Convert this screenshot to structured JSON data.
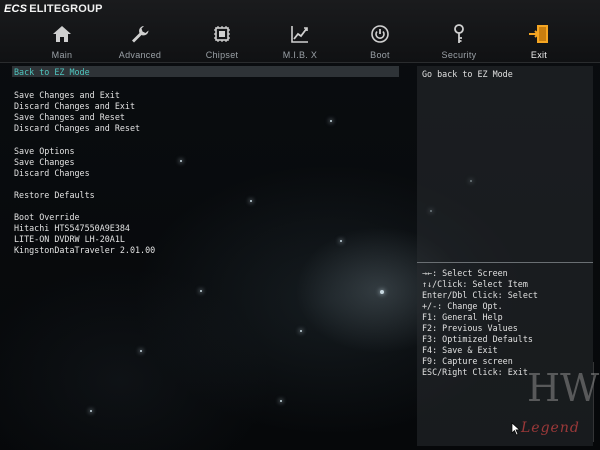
{
  "brand": {
    "logo": "ECS",
    "name": "ELITEGROUP"
  },
  "tabs": [
    {
      "label": "Main",
      "icon": "home-icon"
    },
    {
      "label": "Advanced",
      "icon": "wrench-icon"
    },
    {
      "label": "Chipset",
      "icon": "chip-icon"
    },
    {
      "label": "M.I.B. X",
      "icon": "performance-graph-icon"
    },
    {
      "label": "Boot",
      "icon": "power-icon"
    },
    {
      "label": "Security",
      "icon": "key-icon"
    },
    {
      "label": "Exit",
      "icon": "exit-door-icon",
      "active": true
    }
  ],
  "menu": {
    "back": "Back to EZ Mode",
    "save_group": [
      "Save Changes and Exit",
      "Discard Changes and Exit",
      "Save Changes and Reset",
      "Discard Changes and Reset"
    ],
    "options_group": [
      "Save Options",
      "Save Changes",
      "Discard Changes"
    ],
    "restore": "Restore Defaults",
    "boot_override": {
      "heading": "Boot Override",
      "devices": [
        "Hitachi HTS547550A9E384",
        "LITE-ON DVDRW LH-20A1L",
        "KingstonDataTraveler 2.01.00"
      ]
    }
  },
  "help_text": "Go back to EZ Mode",
  "keys": [
    "→←: Select Screen",
    "↑↓/Click: Select Item",
    "Enter/Dbl Click: Select",
    "+/-: Change Opt.",
    "F1: General Help",
    "F2: Previous Values",
    "F3: Optimized Defaults",
    "F4: Save & Exit",
    "F9: Capture screen",
    "ESC/Right Click: Exit"
  ],
  "watermark": {
    "top": "HW",
    "bottom": "Legend"
  },
  "colors": {
    "accent": "#4fc7c0",
    "exit_icon": "#f5a623",
    "icon": "#d0d0d0"
  }
}
